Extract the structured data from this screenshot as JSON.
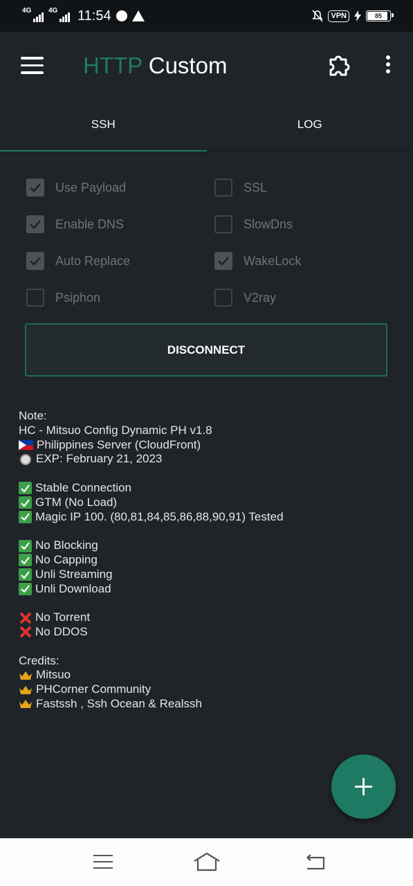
{
  "status_bar": {
    "network_1": "4G",
    "network_2": "4G",
    "time": "11:54",
    "vpn": "VPN",
    "battery_level": "85",
    "battery_fraction": 0.85
  },
  "app_bar": {
    "title_part1": "HTTP",
    "title_part2": "Custom",
    "icons": [
      "menu-icon",
      "puzzle-icon",
      "more-vert-icon"
    ]
  },
  "tabs": [
    {
      "label": "SSH",
      "active": true
    },
    {
      "label": "LOG",
      "active": false
    }
  ],
  "options": [
    {
      "label": "Use Payload",
      "checked": true
    },
    {
      "label": "SSL",
      "checked": false
    },
    {
      "label": "Enable DNS",
      "checked": true
    },
    {
      "label": "SlowDns",
      "checked": false
    },
    {
      "label": "Auto Replace",
      "checked": true
    },
    {
      "label": "WakeLock",
      "checked": true
    },
    {
      "label": "Psiphon",
      "checked": false
    },
    {
      "label": "V2ray",
      "checked": false
    }
  ],
  "disconnect_label": "DISCONNECT",
  "note": {
    "heading": "Note:",
    "config": "HC - Mitsuo Config Dynamic PH v1.8",
    "server": "Philippines Server (CloudFront)",
    "exp": "EXP: February 21, 2023",
    "features_1": [
      "Stable Connection",
      "GTM (No Load)",
      "Magic IP 100. (80,81,84,85,86,88,90,91) Tested"
    ],
    "features_2": [
      "No Blocking",
      "No Capping",
      "Unli Streaming",
      "Unli Download"
    ],
    "restrictions": [
      "No Torrent",
      "No DDOS"
    ],
    "credits_heading": "Credits:",
    "credits": [
      "Mitsuo",
      "PHCorner Community",
      "Fastssh , Ssh Ocean & Realssh"
    ]
  },
  "accent_color": "#1e7a63"
}
